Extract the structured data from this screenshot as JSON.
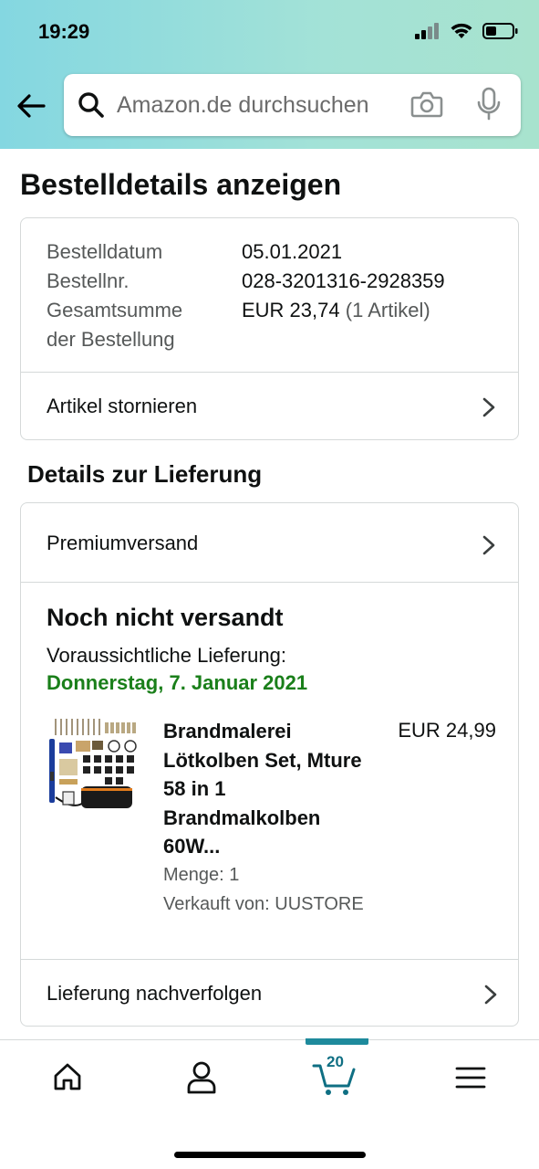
{
  "status_bar": {
    "time": "19:29"
  },
  "search": {
    "placeholder": "Amazon.de durchsuchen"
  },
  "page": {
    "title": "Bestelldetails anzeigen"
  },
  "order_info": {
    "date_label": "Bestelldatum",
    "date_value": "05.01.2021",
    "number_label": "Bestellnr.",
    "number_value": "028-3201316-2928359",
    "total_label_1": "Gesamtsumme",
    "total_label_2": "der Bestellung",
    "total_value": "EUR 23,74",
    "total_items": "(1 Artikel)",
    "cancel_label": "Artikel stornieren"
  },
  "delivery": {
    "section_title": "Details zur Lieferung",
    "shipping_method": "Premiumversand",
    "status": "Noch nicht versandt",
    "expected_label": "Voraussichtliche Lieferung:",
    "expected_date": "Donnerstag, 7. Januar 2021",
    "product": {
      "title": "Brandmalerei Lötkolben Set, Mture 58 in 1 Brandmalkolben 60W...",
      "price": "EUR 24,99",
      "quantity": "Menge: 1",
      "seller": "Verkauft von: UUSTORE"
    },
    "track_label": "Lieferung nachverfolgen"
  },
  "bottom_nav": {
    "cart_count": "20"
  },
  "colors": {
    "header_start": "#84d7e1",
    "header_end": "#a8e3ce",
    "delivery_green": "#1a7f1a",
    "nav_accent": "#1e8a9c"
  }
}
